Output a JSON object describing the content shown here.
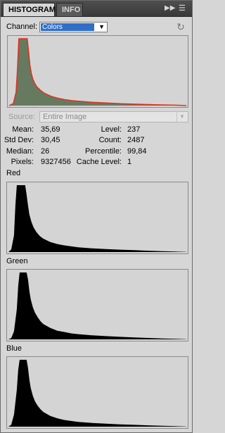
{
  "tabs": [
    {
      "label": "HISTOGRAM",
      "active": true
    },
    {
      "label": "INFO",
      "active": false
    }
  ],
  "toolbar_icons": [
    "fast-forward-icon",
    "panel-menu-icon"
  ],
  "channel": {
    "label": "Channel:",
    "selected": "Colors"
  },
  "source": {
    "label": "Source:",
    "value": "Entire Image"
  },
  "stats": {
    "mean_label": "Mean:",
    "mean": "35,69",
    "std_label": "Std Dev:",
    "std": "30,45",
    "median_label": "Median:",
    "median": "26",
    "pixels_label": "Pixels:",
    "pixels": "9327456",
    "level_label": "Level:",
    "level": "237",
    "count_label": "Count:",
    "count": "2487",
    "percentile_label": "Percentile:",
    "percentile": "99,84",
    "cache_label": "Cache Level:",
    "cache": "1"
  },
  "channels": [
    {
      "label": "Red"
    },
    {
      "label": "Green"
    },
    {
      "label": "Blue"
    }
  ],
  "colors": {
    "panel_bg": "#d6d6d6",
    "tabbar_bg": "#3f3f3f",
    "composite_fill": "#667a60",
    "composite_edge": "#e0301e",
    "channel_fill": "#000000",
    "select_highlight": "#2f6fc7"
  },
  "chart_data": [
    {
      "type": "area",
      "name": "composite",
      "x": [
        0,
        6,
        10,
        12,
        14,
        16,
        18,
        20,
        22,
        24,
        26,
        28,
        30,
        32,
        34,
        36,
        38,
        40,
        45,
        50,
        60,
        70,
        80,
        90,
        100,
        120,
        140,
        160,
        180,
        200,
        220,
        240,
        255
      ],
      "values": [
        0,
        0.03,
        0.2,
        0.55,
        1.0,
        1.0,
        1.0,
        1.0,
        1.0,
        1.0,
        1.0,
        0.8,
        0.6,
        0.48,
        0.4,
        0.35,
        0.31,
        0.28,
        0.23,
        0.19,
        0.14,
        0.11,
        0.09,
        0.075,
        0.065,
        0.05,
        0.04,
        0.03,
        0.022,
        0.016,
        0.011,
        0.006,
        0
      ],
      "xlim": [
        0,
        255
      ],
      "ylim": [
        0,
        1
      ]
    },
    {
      "type": "area",
      "name": "red",
      "x": [
        0,
        4,
        8,
        10,
        12,
        14,
        16,
        18,
        20,
        22,
        24,
        26,
        28,
        30,
        33,
        36,
        40,
        45,
        50,
        60,
        70,
        80,
        90,
        100,
        120,
        140,
        160,
        180,
        200,
        220,
        240,
        255
      ],
      "values": [
        0,
        0.04,
        0.25,
        0.7,
        1.0,
        1.0,
        1.0,
        1.0,
        1.0,
        1.0,
        1.0,
        0.86,
        0.7,
        0.56,
        0.45,
        0.37,
        0.3,
        0.24,
        0.2,
        0.15,
        0.12,
        0.1,
        0.085,
        0.072,
        0.055,
        0.045,
        0.036,
        0.028,
        0.02,
        0.013,
        0.007,
        0.002
      ],
      "xlim": [
        0,
        255
      ],
      "ylim": [
        0,
        1
      ]
    },
    {
      "type": "area",
      "name": "green",
      "x": [
        0,
        4,
        8,
        12,
        14,
        16,
        18,
        20,
        22,
        24,
        26,
        28,
        30,
        32,
        35,
        38,
        42,
        46,
        50,
        60,
        70,
        80,
        90,
        100,
        120,
        140,
        160,
        180,
        200,
        220,
        240,
        255
      ],
      "values": [
        0,
        0.02,
        0.12,
        0.45,
        0.8,
        1.0,
        1.0,
        1.0,
        1.0,
        1.0,
        1.0,
        0.9,
        0.72,
        0.6,
        0.48,
        0.4,
        0.33,
        0.27,
        0.23,
        0.17,
        0.13,
        0.11,
        0.09,
        0.078,
        0.06,
        0.048,
        0.038,
        0.029,
        0.021,
        0.014,
        0.008,
        0.002
      ],
      "xlim": [
        0,
        255
      ],
      "ylim": [
        0,
        1
      ]
    },
    {
      "type": "area",
      "name": "blue",
      "x": [
        0,
        4,
        8,
        12,
        14,
        16,
        18,
        20,
        22,
        24,
        26,
        28,
        30,
        32,
        35,
        38,
        42,
        46,
        50,
        60,
        70,
        80,
        90,
        100,
        120,
        140,
        160,
        180,
        200,
        220,
        240,
        255
      ],
      "values": [
        0,
        0.03,
        0.18,
        0.55,
        0.85,
        1.0,
        1.0,
        1.0,
        1.0,
        1.0,
        1.0,
        0.88,
        0.7,
        0.58,
        0.46,
        0.38,
        0.31,
        0.26,
        0.22,
        0.16,
        0.125,
        0.1,
        0.085,
        0.072,
        0.056,
        0.045,
        0.035,
        0.027,
        0.02,
        0.013,
        0.007,
        0.002
      ],
      "xlim": [
        0,
        255
      ],
      "ylim": [
        0,
        1
      ]
    }
  ]
}
